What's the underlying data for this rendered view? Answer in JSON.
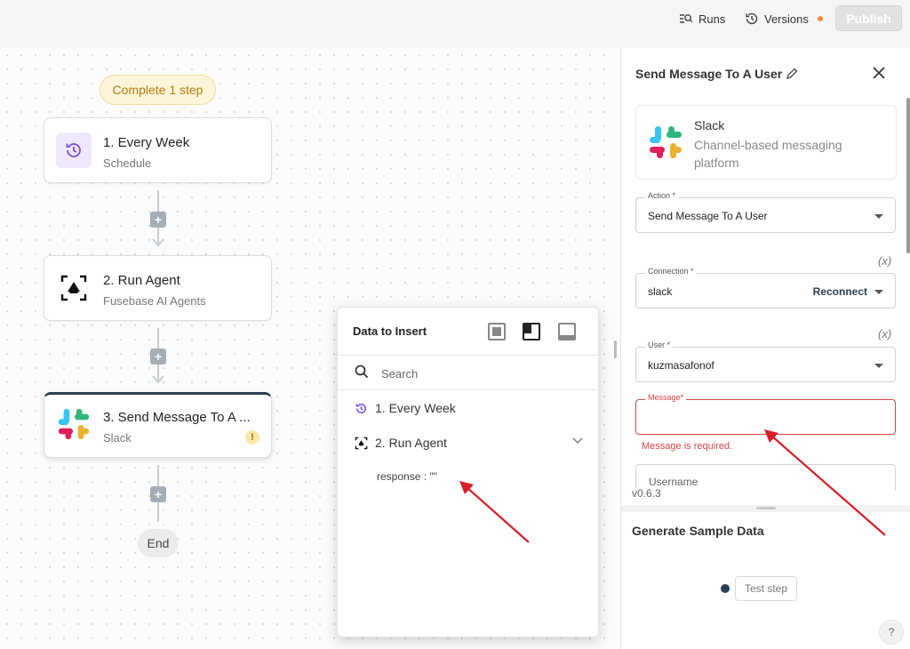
{
  "topbar": {
    "runs_label": "Runs",
    "versions_label": "Versions",
    "publish_label": "Publish"
  },
  "flow": {
    "status_pill": "Complete 1 step",
    "steps": [
      {
        "title": "1. Every Week",
        "subtitle": "Schedule",
        "icon": "schedule-icon"
      },
      {
        "title": "2. Run Agent",
        "subtitle": "Fusebase AI Agents",
        "icon": "fusebase-agent-icon"
      },
      {
        "title": "3. Send Message To A ...",
        "subtitle": "Slack",
        "icon": "slack-icon",
        "warning": "!"
      }
    ],
    "end_label": "End"
  },
  "data_popup": {
    "title": "Data to Insert",
    "search_placeholder": "Search",
    "items": [
      {
        "label": "1. Every Week"
      },
      {
        "label": "2. Run Agent",
        "expanded": true
      }
    ],
    "response_text": "response : \"\""
  },
  "panel": {
    "title": "Send Message To A User",
    "app": {
      "name": "Slack",
      "description": "Channel-based messaging platform"
    },
    "fields": {
      "action": {
        "label": "Action *",
        "value": "Send Message To A User"
      },
      "connection": {
        "label": "Connection *",
        "value": "slack",
        "action_link": "Reconnect"
      },
      "user": {
        "label": "User *",
        "value": "kuzmasafonof"
      },
      "message": {
        "label": "Message*",
        "value": "",
        "error": "Message is required."
      },
      "username": {
        "label": "Username"
      }
    },
    "var_icon": "(x)",
    "version": "v0.6.3",
    "sample_data_title": "Generate Sample Data",
    "test_step_label": "Test step",
    "help_label": "?"
  },
  "colors": {
    "accent_dark": "#2b3e52",
    "error": "#d64545",
    "pill_text": "#b07d0e",
    "annotation_arrow": "#d81f2a"
  }
}
